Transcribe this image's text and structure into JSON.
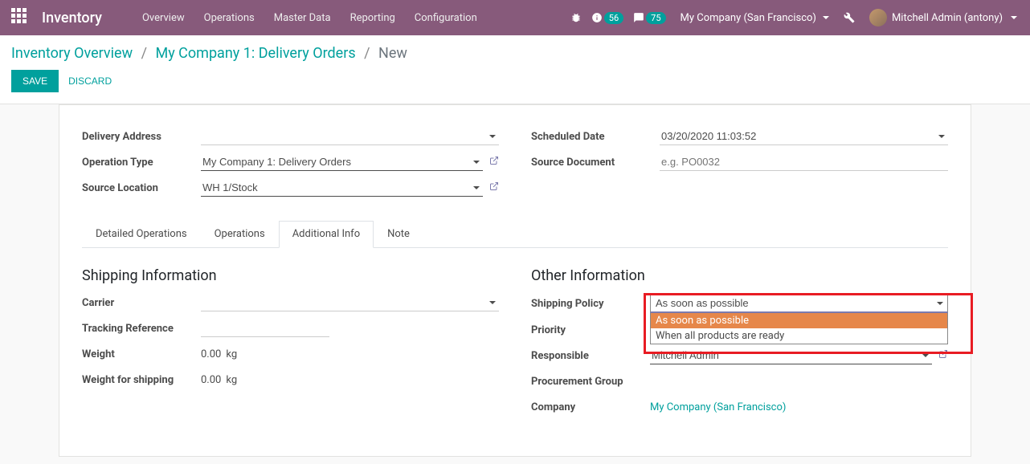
{
  "navbar": {
    "brand": "Inventory",
    "menu": [
      "Overview",
      "Operations",
      "Master Data",
      "Reporting",
      "Configuration"
    ],
    "activity_count": "56",
    "messages_count": "75",
    "company": "My Company (San Francisco)",
    "user": "Mitchell Admin (antony)"
  },
  "breadcrumb": {
    "level1": "Inventory Overview",
    "level2": "My Company 1: Delivery Orders",
    "current": "New"
  },
  "buttons": {
    "save": "SAVE",
    "discard": "DISCARD"
  },
  "form": {
    "delivery_address_label": "Delivery Address",
    "delivery_address_value": "",
    "operation_type_label": "Operation Type",
    "operation_type_value": "My Company 1: Delivery Orders",
    "source_location_label": "Source Location",
    "source_location_value": "WH 1/Stock",
    "scheduled_date_label": "Scheduled Date",
    "scheduled_date_value": "03/20/2020 11:03:52",
    "source_document_label": "Source Document",
    "source_document_placeholder": "e.g. PO0032",
    "source_document_value": ""
  },
  "tabs": {
    "items": [
      "Detailed Operations",
      "Operations",
      "Additional Info",
      "Note"
    ],
    "active": "Additional Info"
  },
  "shipping": {
    "heading": "Shipping Information",
    "carrier_label": "Carrier",
    "carrier_value": "",
    "tracking_label": "Tracking Reference",
    "tracking_value": "",
    "weight_label": "Weight",
    "weight_value": "0.00",
    "weight_unit": "kg",
    "weight_ship_label": "Weight for shipping",
    "weight_ship_value": "0.00",
    "weight_ship_unit": "kg"
  },
  "other": {
    "heading": "Other Information",
    "shipping_policy_label": "Shipping Policy",
    "shipping_policy_value": "As soon as possible",
    "shipping_policy_options": [
      "As soon as possible",
      "When all products are ready"
    ],
    "priority_label": "Priority",
    "responsible_label": "Responsible",
    "responsible_value": "Mitchell Admin",
    "procurement_label": "Procurement Group",
    "company_label": "Company",
    "company_value": "My Company (San Francisco)"
  }
}
